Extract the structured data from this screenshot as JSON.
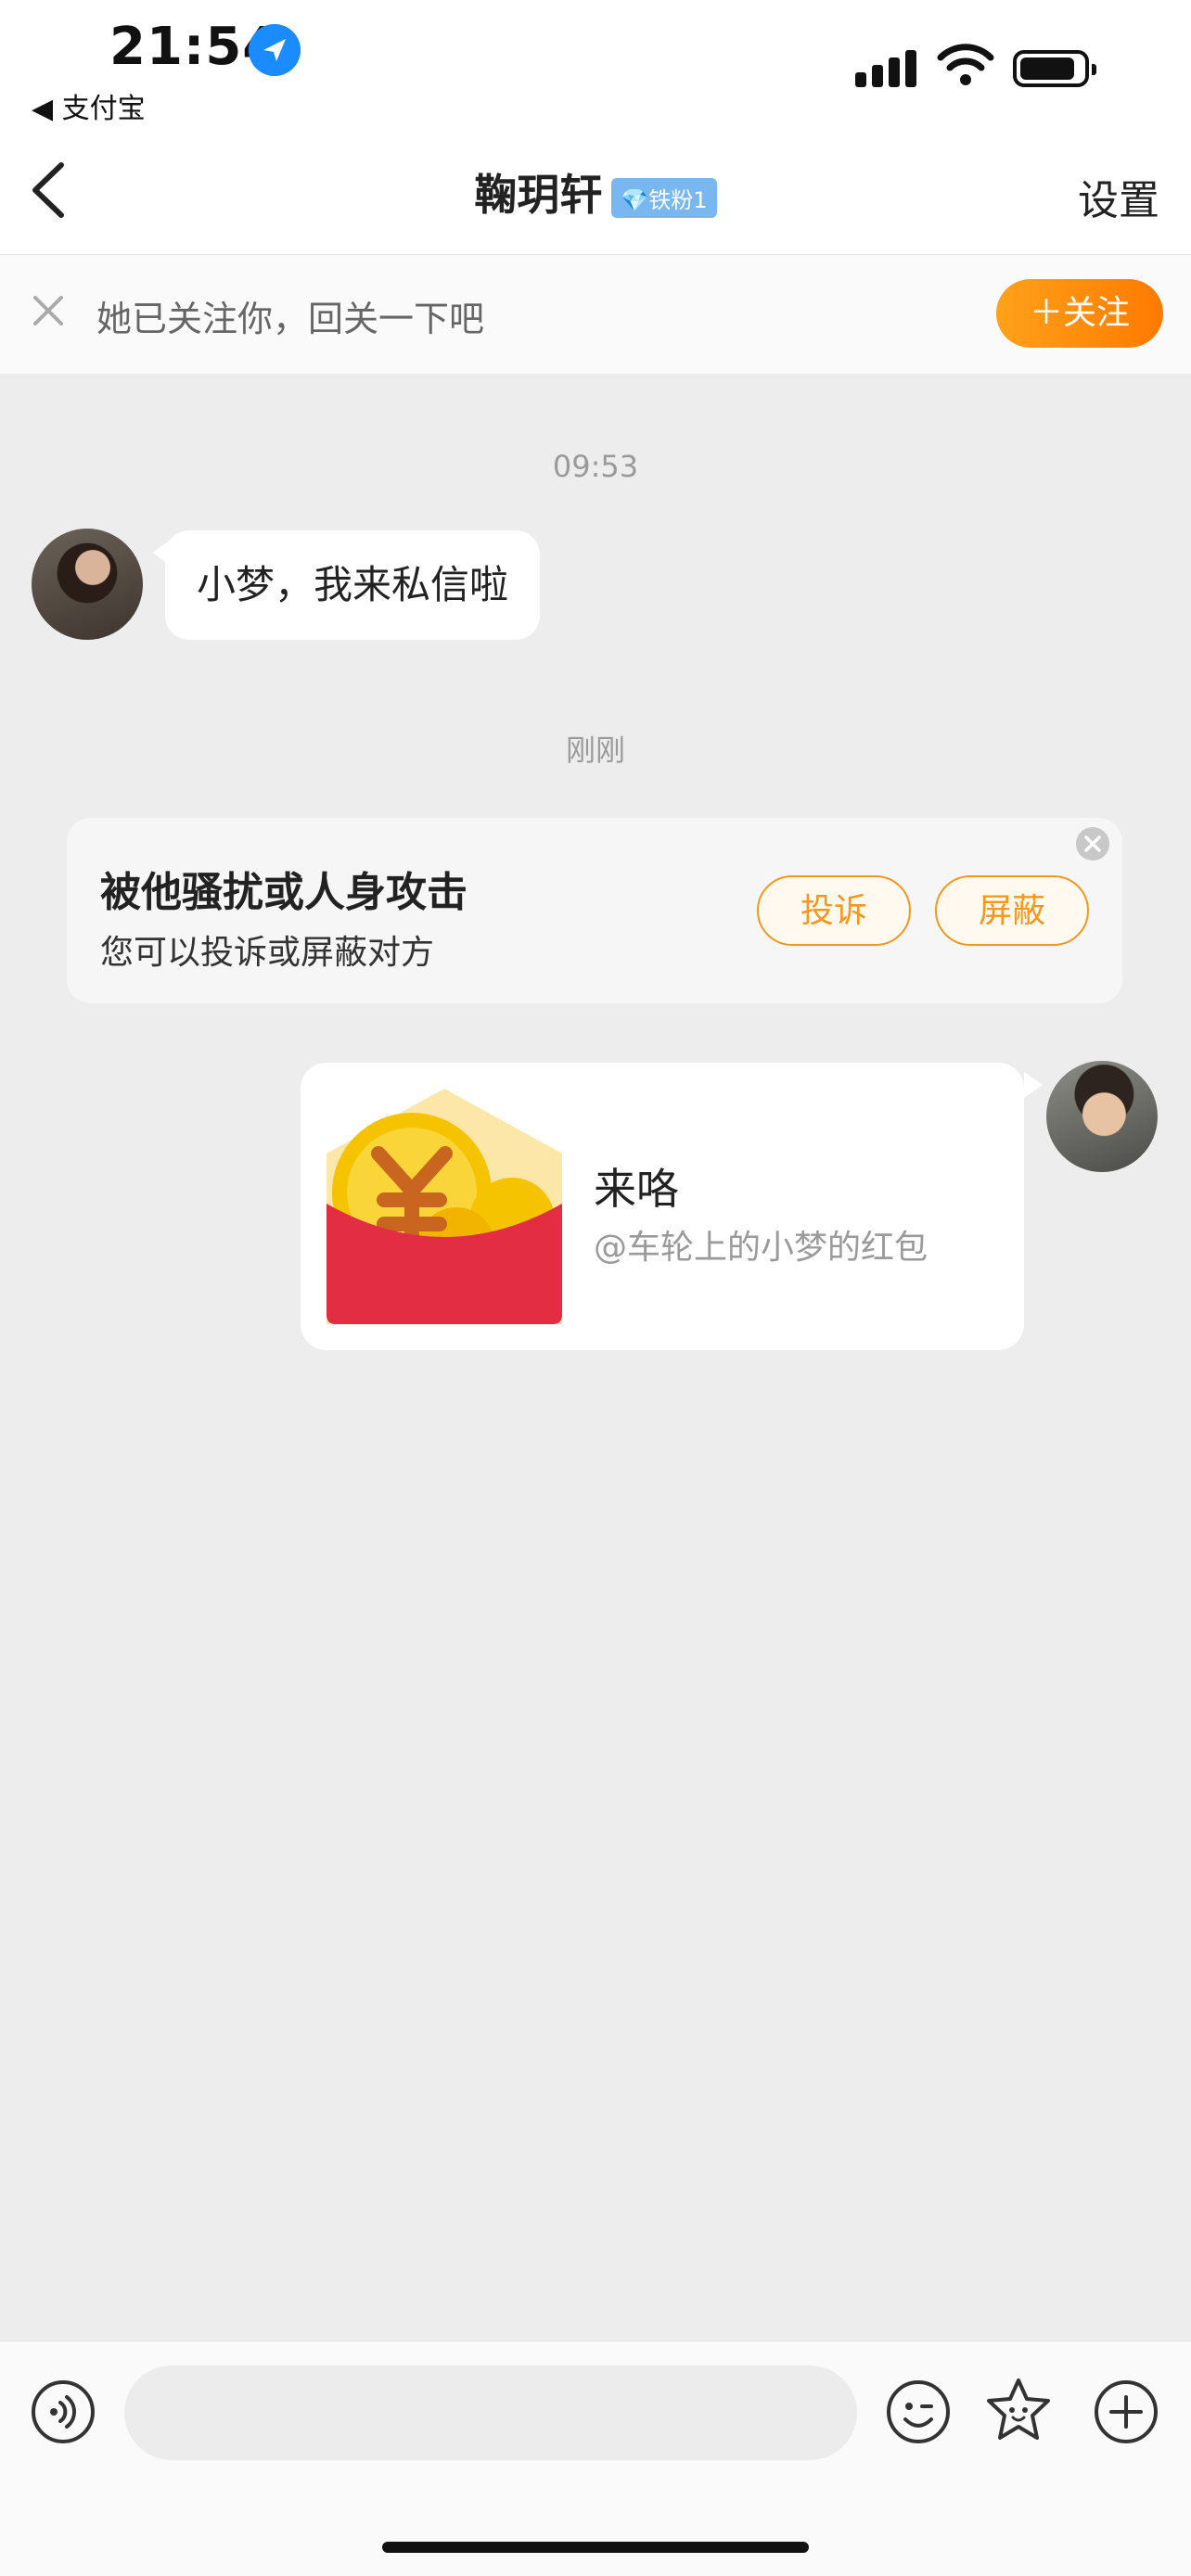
{
  "status_bar": {
    "time": "21:54",
    "back_app": "◀ 支付宝"
  },
  "nav": {
    "title": "鞠玥轩",
    "badge": "💎铁粉1",
    "settings": "设置"
  },
  "follow_bar": {
    "text": "她已关注你，回关一下吧",
    "button": "＋关注"
  },
  "messages": {
    "time_1": "09:53",
    "incoming_text": "小梦，我来私信啦",
    "time_2": "刚刚"
  },
  "report_card": {
    "title": "被他骚扰或人身攻击",
    "subtitle": "您可以投诉或屏蔽对方",
    "report_button": "投诉",
    "block_button": "屏蔽"
  },
  "red_packet": {
    "title": "来咯",
    "subtitle": "@车轮上的小梦的红包"
  },
  "colors": {
    "accent": "#ff8a00",
    "red_packet": "#e22d43",
    "coin": "#f6c300"
  }
}
